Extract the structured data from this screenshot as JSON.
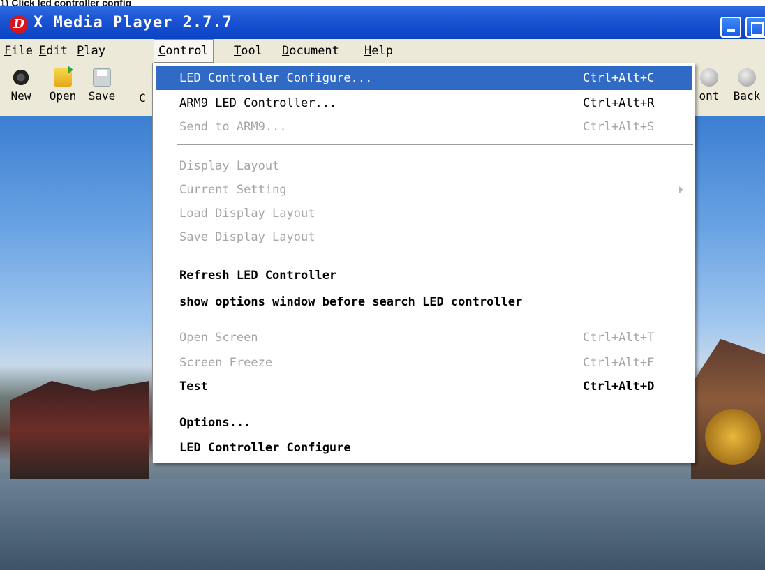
{
  "caption": "1) Click led controller config",
  "window": {
    "title": "X Media Player 2.7.7",
    "logo_glyph": "D"
  },
  "menubar": {
    "items": [
      {
        "label": "File",
        "underline": "F",
        "rest": "ile"
      },
      {
        "label": "Edit",
        "underline": "E",
        "rest": "dit"
      },
      {
        "label": "Play",
        "underline": "P",
        "rest": "lay"
      },
      {
        "label": "Control",
        "underline": "C",
        "rest": "ontrol"
      },
      {
        "label": "Tool",
        "underline": "T",
        "rest": "ool"
      },
      {
        "label": "Document",
        "underline": "D",
        "rest": "ocument"
      },
      {
        "label": "Help",
        "underline": "H",
        "rest": "elp"
      }
    ],
    "active": "Control"
  },
  "toolbar": {
    "new_label": "New",
    "open_label": "Open",
    "save_label": "Save",
    "c_label": "C",
    "front_label": "ont",
    "back_label": "Back"
  },
  "control_menu": {
    "items": [
      {
        "label": "LED Controller Configure...",
        "shortcut": "Ctrl+Alt+C",
        "state": "highlighted"
      },
      {
        "label": "ARM9 LED Controller...",
        "shortcut": "Ctrl+Alt+R",
        "state": "enabled"
      },
      {
        "label": "Send to ARM9...",
        "shortcut": "Ctrl+Alt+S",
        "state": "disabled"
      },
      {
        "label": "Display Layout",
        "shortcut": "",
        "state": "disabled"
      },
      {
        "label": "Current Setting",
        "shortcut": "",
        "state": "disabled",
        "submenu": true
      },
      {
        "label": "Load Display Layout",
        "shortcut": "",
        "state": "disabled"
      },
      {
        "label": "Save Display Layout",
        "shortcut": "",
        "state": "disabled"
      },
      {
        "label": "Refresh LED Controller",
        "shortcut": "",
        "state": "enabled"
      },
      {
        "label": "show options window before search LED controller",
        "shortcut": "",
        "state": "enabled"
      },
      {
        "label": "Open Screen",
        "shortcut": "Ctrl+Alt+T",
        "state": "disabled"
      },
      {
        "label": "Screen Freeze",
        "shortcut": "Ctrl+Alt+F",
        "state": "disabled"
      },
      {
        "label": "Test",
        "shortcut": "Ctrl+Alt+D",
        "state": "enabled"
      },
      {
        "label": "Options...",
        "shortcut": "",
        "state": "enabled"
      },
      {
        "label": "LED Controller Configure",
        "shortcut": "",
        "state": "enabled"
      }
    ]
  }
}
